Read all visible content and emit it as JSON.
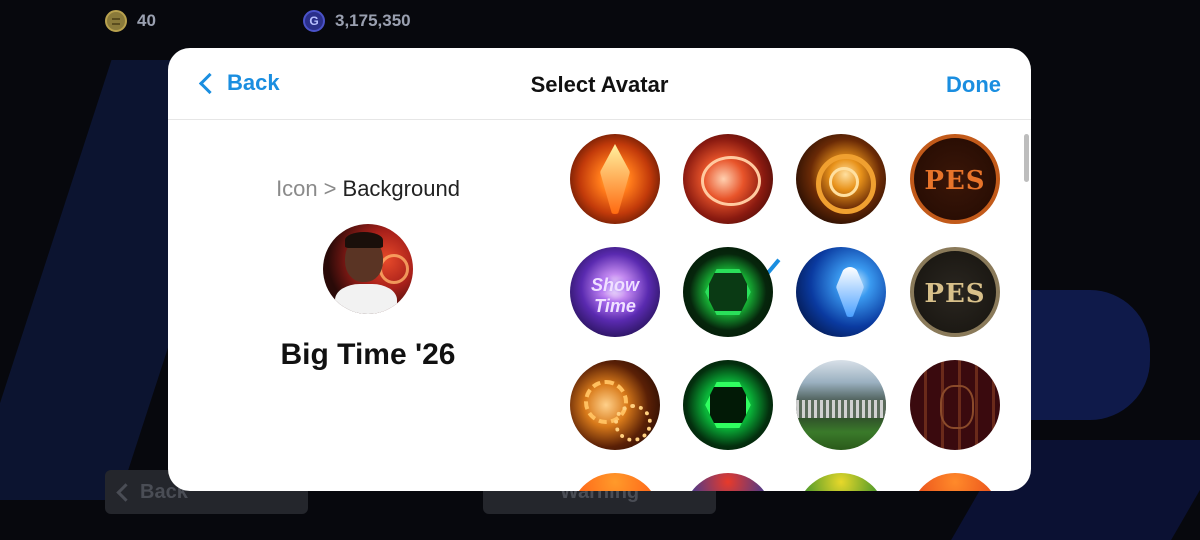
{
  "background_screen": {
    "coins": "40",
    "gp": "3,175,350",
    "gp_icon_letter": "G",
    "back_label": "Back",
    "warning_label": "Warning"
  },
  "header": {
    "back_label": "Back",
    "title": "Select Avatar",
    "done_label": "Done"
  },
  "preview": {
    "breadcrumb_parent": "Icon",
    "breadcrumb_separator": ">",
    "breadcrumb_current": "Background",
    "name": "Big Time '26"
  },
  "avatars": [
    {
      "id": "fire-crystal",
      "selected": false
    },
    {
      "id": "red-neon-badge",
      "selected": true
    },
    {
      "id": "golden-rings",
      "selected": false
    },
    {
      "id": "pes-bronze",
      "selected": false,
      "text": "PES"
    },
    {
      "id": "show-time-purple",
      "selected": false,
      "text": "Show Time"
    },
    {
      "id": "green-hexagon-tunnel",
      "selected": false
    },
    {
      "id": "blue-trophy",
      "selected": false
    },
    {
      "id": "pes-gold",
      "selected": false,
      "text": "PES"
    },
    {
      "id": "golden-gears",
      "selected": false
    },
    {
      "id": "green-hexagon",
      "selected": false
    },
    {
      "id": "stadium-pitch",
      "selected": false
    },
    {
      "id": "maroon-pattern",
      "selected": false
    },
    {
      "id": "orange-wave",
      "selected": false
    },
    {
      "id": "blue-red-pattern",
      "selected": false
    },
    {
      "id": "green-yellow-pattern",
      "selected": false
    },
    {
      "id": "orange-pattern",
      "selected": false
    }
  ],
  "colors": {
    "accent": "#1a8ee0",
    "modal_bg": "#ffffff",
    "screen_bg": "#07080d"
  }
}
